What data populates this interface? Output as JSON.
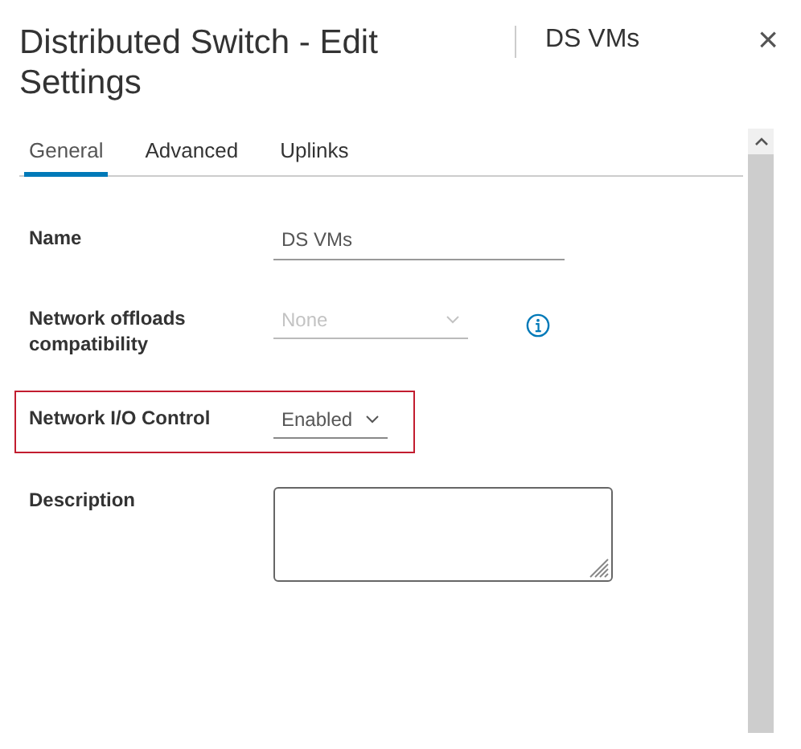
{
  "dialog": {
    "title": "Distributed Switch - Edit Settings",
    "subtitle": "DS VMs",
    "close": "×"
  },
  "tabs": [
    {
      "label": "General",
      "selected": true
    },
    {
      "label": "Advanced",
      "selected": false
    },
    {
      "label": "Uplinks",
      "selected": false
    }
  ],
  "fields": [
    {
      "kind": "text",
      "label": "Name",
      "value": "DS VMs",
      "highlighted": false,
      "disabled": false,
      "info": false
    },
    {
      "kind": "select",
      "label": "Network offloads compatibility",
      "value": "None",
      "highlighted": false,
      "disabled": true,
      "info": true
    },
    {
      "kind": "select",
      "label": "Network I/O Control",
      "value": "Enabled",
      "highlighted": true,
      "disabled": false,
      "info": false
    },
    {
      "kind": "textarea",
      "label": "Description",
      "highlighted": false,
      "disabled": false,
      "info": false
    }
  ]
}
